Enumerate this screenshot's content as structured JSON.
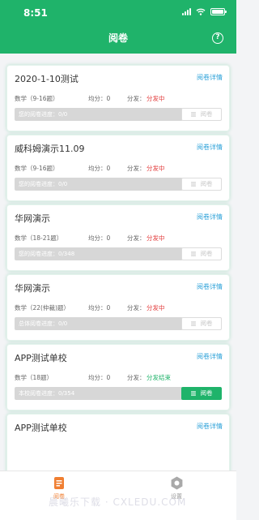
{
  "status_bar": {
    "time": "8:51"
  },
  "header": {
    "title": "阅卷",
    "help_label": "?"
  },
  "cards": [
    {
      "name": "2020-1-10测试",
      "detail": "阅卷详情",
      "subject": "数学（9-16题）",
      "avg": "均分：0",
      "dist_label": "分发：",
      "dist_status": "分发中",
      "progress": "您的阅卷进度：0/0",
      "button": "阅卷"
    },
    {
      "name": "威科姆演示11.09",
      "detail": "阅卷详情",
      "subject": "数学（9-16题）",
      "avg": "均分：0",
      "dist_label": "分发：",
      "dist_status": "分发中",
      "progress": "您的阅卷进度：0/0",
      "button": "阅卷"
    },
    {
      "name": "华网演示",
      "detail": "阅卷详情",
      "subject": "数学（18-21题）",
      "avg": "均分：0",
      "dist_label": "分发：",
      "dist_status": "分发中",
      "progress": "您的阅卷进度：0/348",
      "button": "阅卷"
    },
    {
      "name": "华网演示",
      "detail": "阅卷详情",
      "subject": "数学（22(仲裁)题）",
      "avg": "均分：0",
      "dist_label": "分发：",
      "dist_status": "分发中",
      "progress": "总体阅卷进度：0/0",
      "button": "阅卷"
    },
    {
      "name": "APP测试单校",
      "detail": "阅卷详情",
      "subject": "数学（18题）",
      "avg": "均分：0",
      "dist_label": "分发：",
      "dist_status": "分发结束",
      "progress": "本校阅卷进度：0/354",
      "button": "阅卷"
    },
    {
      "name": "APP测试单校",
      "detail": "阅卷详情"
    }
  ],
  "tabs": [
    {
      "label": "阅卷",
      "icon": "document-icon"
    },
    {
      "label": "设置",
      "icon": "gear-icon"
    }
  ],
  "watermark": "晨曦乐下载 · CXLEDU.COM",
  "colors": {
    "brand_green": "#1fb36a",
    "status_red": "#e23b3b",
    "link_blue": "#2aa0d8",
    "tab_active": "#f07f32"
  }
}
